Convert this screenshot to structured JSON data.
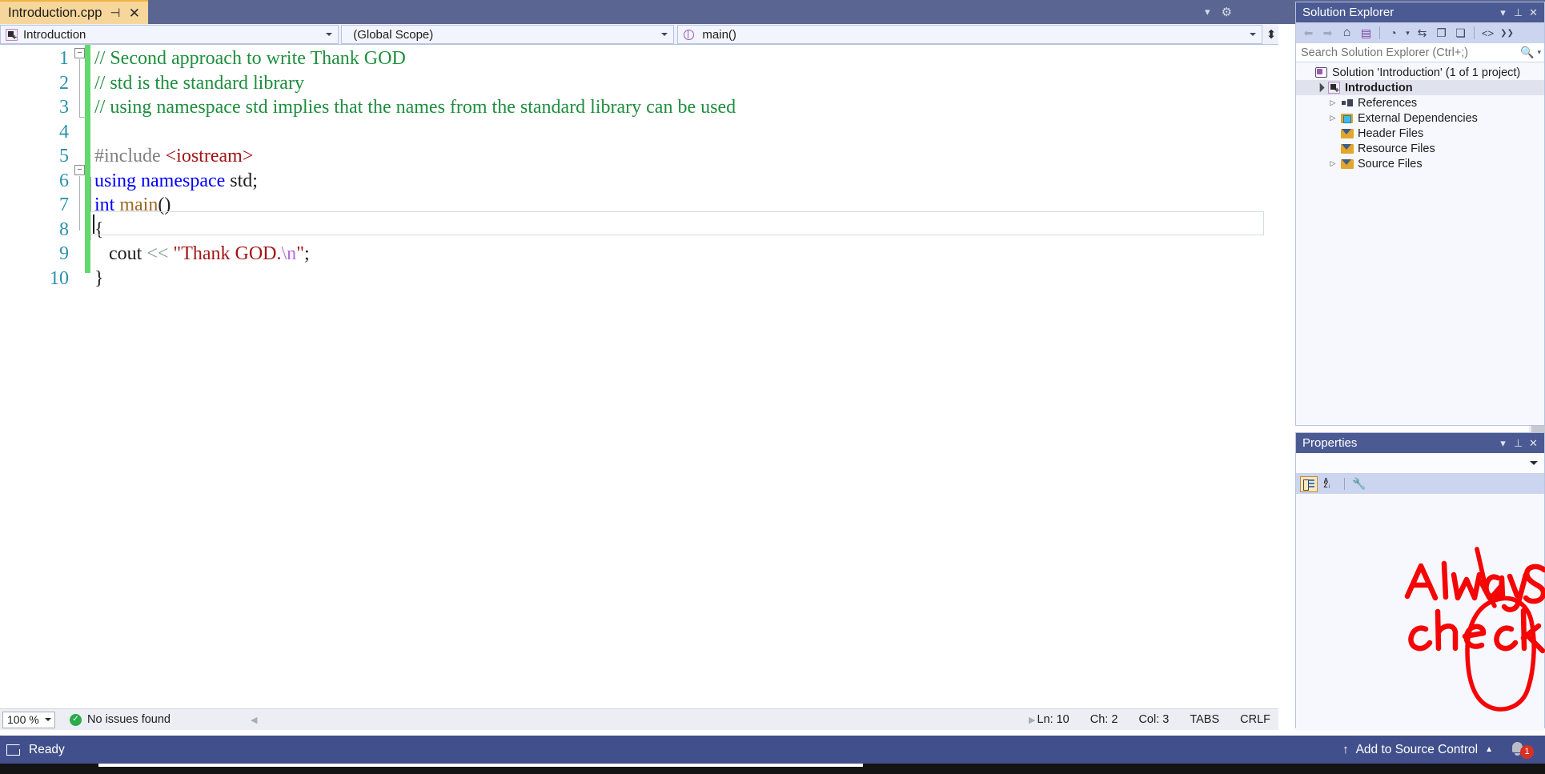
{
  "window": {
    "tab": {
      "title": "Introduction.cpp",
      "pin_icon": "pin-icon",
      "close_icon": "close-icon"
    },
    "top_right": {
      "dropdown_icon": "chevron-down-icon",
      "settings_icon": "gear-icon"
    }
  },
  "navbar": {
    "project_selector": {
      "value": "Introduction",
      "icon": "project-icon"
    },
    "scope_selector": {
      "value": "(Global Scope)"
    },
    "member_selector": {
      "value": "main()",
      "icon": "method-icon"
    },
    "split_button_icon": "split-view-icon"
  },
  "editor": {
    "line_numbers": [
      "1",
      "2",
      "3",
      "4",
      "5",
      "6",
      "7",
      "8",
      "9",
      "10"
    ],
    "lines": [
      {
        "n": 1,
        "tokens": [
          {
            "t": "// Second approach to write Thank GOD",
            "c": "cmt"
          }
        ]
      },
      {
        "n": 2,
        "tokens": [
          {
            "t": "// std is the standard library",
            "c": "cmt"
          }
        ]
      },
      {
        "n": 3,
        "tokens": [
          {
            "t": "// using namespace std implies that the names from the standard library can be used",
            "c": "cmt"
          }
        ]
      },
      {
        "n": 4,
        "tokens": []
      },
      {
        "n": 5,
        "tokens": [
          {
            "t": "#include ",
            "c": "pp"
          },
          {
            "t": "<iostream>",
            "c": "inc"
          }
        ]
      },
      {
        "n": 6,
        "tokens": [
          {
            "t": "using namespace ",
            "c": "kw"
          },
          {
            "t": "std;",
            "c": "typ"
          }
        ]
      },
      {
        "n": 7,
        "tokens": [
          {
            "t": "int ",
            "c": "kw"
          },
          {
            "t": "main",
            "c": "fn"
          },
          {
            "t": "()",
            "c": "blk"
          }
        ]
      },
      {
        "n": 8,
        "tokens": [
          {
            "t": "{",
            "c": "blk"
          }
        ]
      },
      {
        "n": 9,
        "tokens": [
          {
            "t": "   cout ",
            "c": "blk"
          },
          {
            "t": "<< ",
            "c": "op"
          },
          {
            "t": "\"Thank GOD.",
            "c": "str"
          },
          {
            "t": "\\n",
            "c": "esc"
          },
          {
            "t": "\"",
            "c": "str"
          },
          {
            "t": ";",
            "c": "blk"
          }
        ]
      },
      {
        "n": 10,
        "tokens": [
          {
            "t": "}",
            "c": "blk"
          }
        ]
      }
    ],
    "fold_markers": [
      "collapse-line-1",
      "collapse-line-7"
    ]
  },
  "editor_status": {
    "zoom": "100 %",
    "issues": "No issues found",
    "issues_icon": "success-check-icon",
    "line": "Ln: 10",
    "ch": "Ch: 2",
    "col": "Col: 3",
    "indent": "TABS",
    "eol": "CRLF",
    "scroll_left_icon": "scroll-left-icon",
    "scroll_right_icon": "scroll-right-icon"
  },
  "solution_explorer": {
    "title": "Solution Explorer",
    "titlebar_buttons": [
      {
        "name": "dropdown-icon",
        "glyph": "▾"
      },
      {
        "name": "pin-icon",
        "glyph": "⊥"
      },
      {
        "name": "close-icon",
        "glyph": "✕"
      }
    ],
    "toolbar": [
      {
        "name": "back-icon",
        "glyph": "◀"
      },
      {
        "name": "forward-icon",
        "glyph": "▶"
      },
      {
        "name": "home-icon",
        "glyph": "⌂"
      },
      {
        "name": "sync-with-active-document-icon",
        "glyph": "⇄"
      },
      {
        "name": "pending-changes-filter-icon",
        "glyph": "◔"
      },
      {
        "name": "filter-dropdown-icon",
        "glyph": "▾"
      },
      {
        "name": "refresh-icon",
        "glyph": "⇆"
      },
      {
        "name": "collapse-all-icon",
        "glyph": "❐"
      },
      {
        "name": "show-all-files-icon",
        "glyph": "❏"
      },
      {
        "name": "view-code-icon",
        "glyph": "<>"
      },
      {
        "name": "overflow-icon",
        "glyph": "❯❯"
      }
    ],
    "search_placeholder": "Search Solution Explorer (Ctrl+;)",
    "search_value": "",
    "search_icon": "search-icon",
    "search_dropdown_icon": "chevron-down-icon",
    "tree": [
      {
        "label": "Solution 'Introduction' (1 of 1 project)",
        "indent": 0,
        "expander": "",
        "icon": "solution-icon",
        "selected": false,
        "bold": false
      },
      {
        "label": "Introduction",
        "indent": 1,
        "expander": "▲",
        "icon": "project-icon",
        "selected": true,
        "bold": true
      },
      {
        "label": "References",
        "indent": 2,
        "expander": "▷",
        "icon": "references-icon",
        "selected": false,
        "bold": false
      },
      {
        "label": "External Dependencies",
        "indent": 2,
        "expander": "▷",
        "icon": "external-dependencies-icon",
        "selected": false,
        "bold": false
      },
      {
        "label": "Header Files",
        "indent": 2,
        "expander": "",
        "icon": "filter-folder-icon",
        "selected": false,
        "bold": false
      },
      {
        "label": "Resource Files",
        "indent": 2,
        "expander": "",
        "icon": "filter-folder-icon",
        "selected": false,
        "bold": false
      },
      {
        "label": "Source Files",
        "indent": 2,
        "expander": "▷",
        "icon": "filter-folder-icon",
        "selected": false,
        "bold": false
      }
    ]
  },
  "properties": {
    "title": "Properties",
    "titlebar_buttons": [
      {
        "name": "dropdown-icon",
        "glyph": "▾"
      },
      {
        "name": "pin-icon",
        "glyph": "⊥"
      },
      {
        "name": "close-icon",
        "glyph": "✕"
      }
    ],
    "object_selector_value": "",
    "object_selector_icon": "chevron-down-icon",
    "toolbar": [
      {
        "name": "categorized-sort-button",
        "glyph": "cat",
        "active": true
      },
      {
        "name": "alphabetical-sort-button",
        "glyph": "az",
        "active": false
      },
      {
        "name": "property-pages-button",
        "glyph": "wrench",
        "active": false
      }
    ]
  },
  "statusbar": {
    "status_icon": "ready-flag-icon",
    "status_text": "Ready",
    "source_control_arrow_icon": "upload-arrow-icon",
    "source_control_label": "Add to Source Control",
    "source_control_caret_icon": "chevron-up-icon",
    "notification_icon": "bell-icon",
    "notification_count": "1"
  },
  "annotation": {
    "text_line1": "Always",
    "text_line2": "check",
    "color": "#f50505",
    "shapes": [
      "handwritten-text",
      "down-arrow",
      "circle-highlight"
    ]
  }
}
